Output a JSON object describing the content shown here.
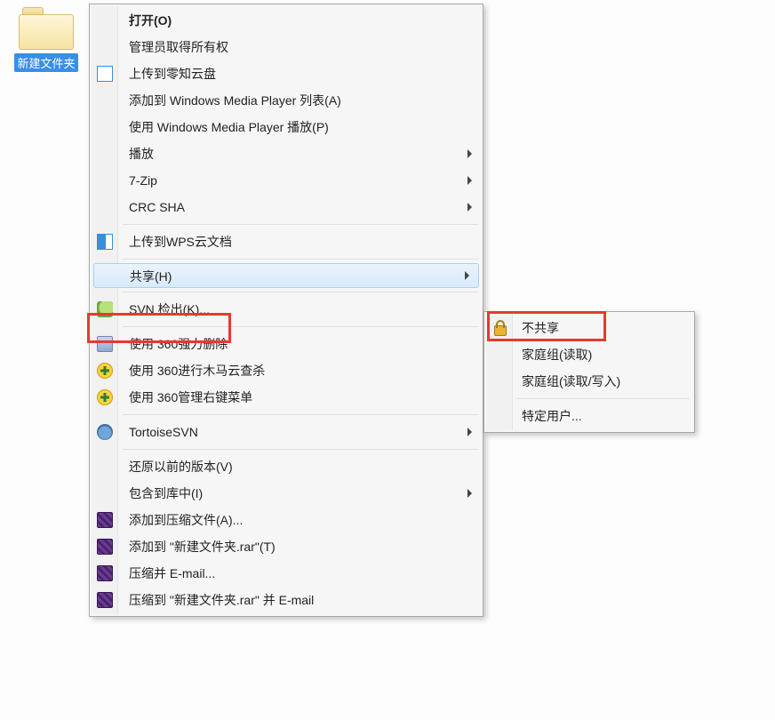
{
  "desktop": {
    "folder_label": "新建文件夹"
  },
  "menu": {
    "open": "打开(O)",
    "take_ownership": "管理员取得所有权",
    "upload_cloud": "上传到零知云盘",
    "add_wmp_list": "添加到 Windows Media Player 列表(A)",
    "play_wmp": "使用 Windows Media Player 播放(P)",
    "play": "播放",
    "seven_zip": "7-Zip",
    "crc_sha": "CRC SHA",
    "upload_wps": "上传到WPS云文档",
    "share": "共享(H)",
    "svn_checkout": "SVN 检出(K)...",
    "del_360": "使用 360强力删除",
    "scan_360": "使用 360进行木马云查杀",
    "menu_360": "使用 360管理右键菜单",
    "tortoise": "TortoiseSVN",
    "restore_prev": "还原以前的版本(V)",
    "include_lib": "包含到库中(I)",
    "add_archive": "添加到压缩文件(A)...",
    "add_archive_named": "添加到 \"新建文件夹.rar\"(T)",
    "compress_email": "压缩并 E-mail...",
    "compress_named_email": "压缩到 \"新建文件夹.rar\" 并 E-mail"
  },
  "submenu": {
    "no_share": "不共享",
    "homegroup_read": "家庭组(读取)",
    "homegroup_rw": "家庭组(读取/写入)",
    "specific_users": "特定用户..."
  }
}
